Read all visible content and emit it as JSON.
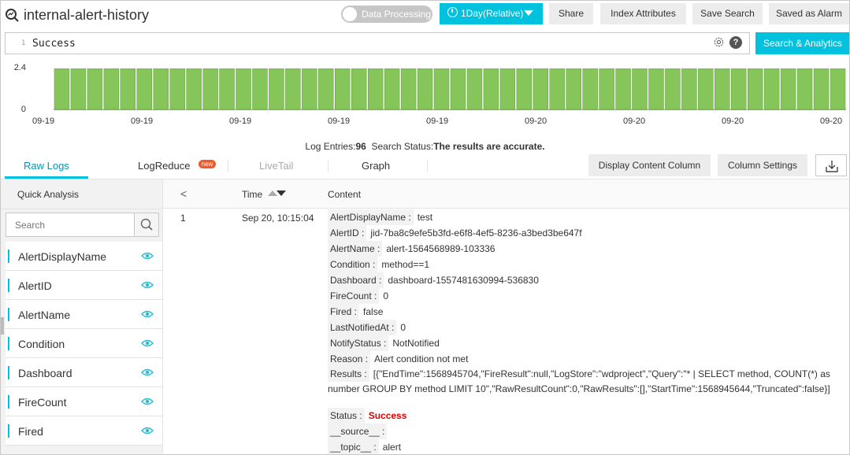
{
  "header": {
    "logstore_icon": "logstore-search-icon",
    "title": "internal-alert-history",
    "toggle_label": "Data Processing",
    "time_range": "1Day(Relative)",
    "buttons": {
      "share": "Share",
      "index_attributes": "Index Attributes",
      "save_search": "Save Search",
      "saved_as_alarm": "Saved as Alarm"
    }
  },
  "query": {
    "line_number": "1",
    "text": "Success",
    "search_button": "Search & Analytics",
    "help": "?"
  },
  "chart_data": {
    "type": "bar",
    "yticks": [
      "2.4",
      "0"
    ],
    "ylim": [
      0,
      2.4
    ],
    "xticks": [
      "09-19",
      "09-19",
      "09-19",
      "09-19",
      "09-19",
      "09-20",
      "09-20",
      "09-20",
      "09-20"
    ],
    "values": [
      2,
      2,
      2,
      2,
      2,
      2,
      2,
      2,
      2,
      2,
      2,
      2,
      2,
      2,
      2,
      2,
      2,
      2,
      2,
      2,
      2,
      2,
      2,
      2,
      2,
      2,
      2,
      2,
      2,
      2,
      2,
      2,
      2,
      2,
      2,
      2,
      2,
      2,
      2,
      2,
      2,
      2,
      2,
      2,
      2,
      2,
      2,
      2
    ],
    "bar_color": "#85c55a",
    "bar_border": "#5d9e36"
  },
  "status": {
    "entries_label": "Log Entries:",
    "entries_value": "96",
    "search_label": "Search Status:",
    "search_value": "The results are accurate."
  },
  "tabs": {
    "raw_logs": "Raw Logs",
    "logreduce": "LogReduce",
    "logreduce_badge": "new",
    "livetail": "LiveTail",
    "graph": "Graph"
  },
  "toolbar": {
    "display_content_column": "Display Content Column",
    "column_settings": "Column Settings",
    "download_icon": "download-icon"
  },
  "sidebar": {
    "title": "Quick Analysis",
    "search_placeholder": "Search",
    "fields": [
      "AlertDisplayName",
      "AlertID",
      "AlertName",
      "Condition",
      "Dashboard",
      "FireCount",
      "Fired"
    ]
  },
  "table": {
    "back": "<",
    "time_header": "Time",
    "content_header": "Content",
    "row": {
      "index": "1",
      "time": "Sep 20, 10:15:04",
      "fields": [
        {
          "key": "AlertDisplayName :",
          "value": "test"
        },
        {
          "key": "AlertID :",
          "value": "jid-7ba8c9efe5b3fd-e6f8-4ef5-8236-a3bed3be647f"
        },
        {
          "key": "AlertName :",
          "value": "alert-1564568989-103336"
        },
        {
          "key": "Condition :",
          "value": "method==1"
        },
        {
          "key": "Dashboard :",
          "value": "dashboard-1557481630994-536830"
        },
        {
          "key": "FireCount :",
          "value": "0"
        },
        {
          "key": "Fired :",
          "value": "false"
        },
        {
          "key": "LastNotifiedAt :",
          "value": "0"
        },
        {
          "key": "NotifyStatus :",
          "value": "NotNotified"
        },
        {
          "key": "Reason :",
          "value": "Alert condition not met"
        },
        {
          "key": "Results :",
          "value": "[{\"EndTime\":1568945704,\"FireResult\":null,\"LogStore\":\"wdproject\",\"Query\":\"* | SELECT method, COUNT(*) as number GROUP BY method LIMIT 10\",\"RawResultCount\":0,\"RawResults\":[],\"StartTime\":1568945644,\"Truncated\":false}]"
        },
        {
          "key": "Status :",
          "value": "Success"
        },
        {
          "key": "__source__ :",
          "value": ""
        },
        {
          "key": "__topic__ :",
          "value": "alert"
        }
      ]
    }
  }
}
